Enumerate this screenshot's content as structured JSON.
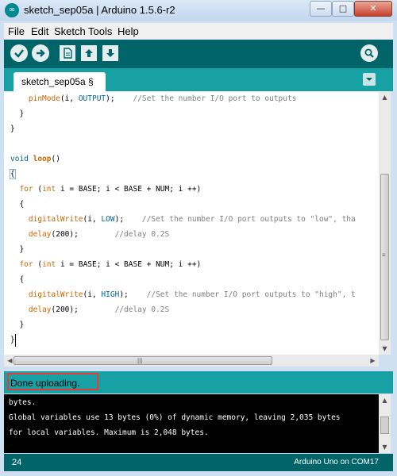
{
  "window": {
    "title": "sketch_sep05a | Arduino 1.5.6-r2",
    "icon": "arduino-logo-icon",
    "icon_glyph": "∞"
  },
  "window_controls": {
    "minimize": "—",
    "maximize": "□",
    "close": "✕"
  },
  "menu": [
    "File",
    "Edit",
    "Sketch",
    "Tools",
    "Help"
  ],
  "toolbar": {
    "buttons": [
      "verify-icon",
      "upload-icon",
      "new-icon",
      "open-icon",
      "save-icon"
    ],
    "serial_monitor": "serial-monitor-icon"
  },
  "tabs": [
    {
      "label": "sketch_sep05a §"
    }
  ],
  "editor": {
    "lines": [
      [
        {
          "t": "    "
        },
        {
          "t": "pinMode",
          "c": "fn"
        },
        {
          "t": "(i, "
        },
        {
          "t": "OUTPUT",
          "c": "cn"
        },
        {
          "t": ");    "
        },
        {
          "t": "//Set the number I/O port to outputs",
          "c": "cm"
        }
      ],
      [
        {
          "t": "  }"
        }
      ],
      [
        {
          "t": "}"
        }
      ],
      [
        {
          "t": ""
        }
      ],
      [
        {
          "t": "void ",
          "c": "kw2"
        },
        {
          "t": "loop",
          "c": "kw bold"
        },
        {
          "t": "()"
        }
      ],
      [
        {
          "t": "{",
          "c": "brace-hl"
        }
      ],
      [
        {
          "t": "  "
        },
        {
          "t": "for",
          "c": "kw"
        },
        {
          "t": " ("
        },
        {
          "t": "int",
          "c": "kw"
        },
        {
          "t": " i = BASE; i < BASE + NUM; i ++)"
        }
      ],
      [
        {
          "t": "  {"
        }
      ],
      [
        {
          "t": "    "
        },
        {
          "t": "digitalWrite",
          "c": "fn"
        },
        {
          "t": "(i, "
        },
        {
          "t": "LOW",
          "c": "cn"
        },
        {
          "t": ");    "
        },
        {
          "t": "//Set the number I/O port outputs to \"low\", tha",
          "c": "cm"
        }
      ],
      [
        {
          "t": "    "
        },
        {
          "t": "delay",
          "c": "fn"
        },
        {
          "t": "(200);        "
        },
        {
          "t": "//delay 0.2S",
          "c": "cm"
        }
      ],
      [
        {
          "t": "  }"
        }
      ],
      [
        {
          "t": "  "
        },
        {
          "t": "for",
          "c": "kw"
        },
        {
          "t": " ("
        },
        {
          "t": "int",
          "c": "kw"
        },
        {
          "t": " i = BASE; i < BASE + NUM; i ++)"
        }
      ],
      [
        {
          "t": "  {"
        }
      ],
      [
        {
          "t": "    "
        },
        {
          "t": "digitalWrite",
          "c": "fn"
        },
        {
          "t": "(i, "
        },
        {
          "t": "HIGH",
          "c": "cn"
        },
        {
          "t": ");    "
        },
        {
          "t": "//Set the number I/O port outputs to \"high\", t",
          "c": "cm"
        }
      ],
      [
        {
          "t": "    "
        },
        {
          "t": "delay",
          "c": "fn"
        },
        {
          "t": "(200);        "
        },
        {
          "t": "//delay 0.2S",
          "c": "cm"
        }
      ],
      [
        {
          "t": "  }"
        }
      ],
      [
        {
          "t": "}"
        }
      ]
    ]
  },
  "scrollbar_glyphs": {
    "up": "▲",
    "down": "▼",
    "left": "◀",
    "right": "▶",
    "grip": "≡",
    "hgrip": "|||"
  },
  "status": {
    "message": "Done uploading."
  },
  "console": {
    "lines": [
      "bytes.",
      "Global variables use 13 bytes (0%) of dynamic memory, leaving 2,035 bytes",
      "for local variables. Maximum is 2,048 bytes."
    ]
  },
  "footer": {
    "line_number": "24",
    "board": "Arduino Uno on COM17"
  },
  "colors": {
    "teal_dark": "#006468",
    "teal_light": "#17a1a5",
    "highlight_box": "#e53b3b"
  }
}
